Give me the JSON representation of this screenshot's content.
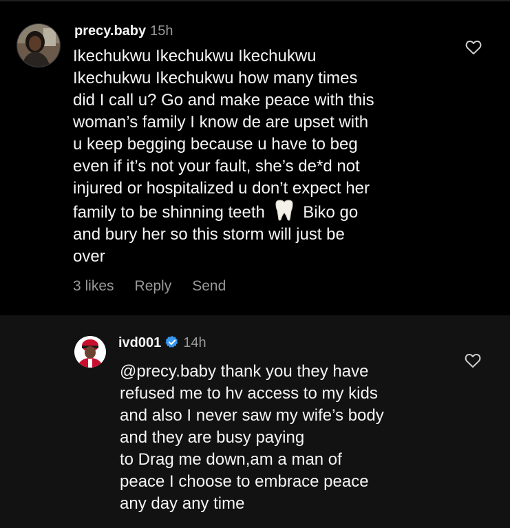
{
  "comments": [
    {
      "username": "precy.baby",
      "time": "15h",
      "lines": [
        "Ikechukwu Ikechukwu Ikechukwu",
        "Ikechukwu Ikechukwu how many times",
        "did I call u? Go and make peace with this",
        "woman’s family I know de are upset with",
        "u keep begging because u have to beg",
        "even if it’s not your fault, she’s de*d not",
        "injured or hospitalized u don’t expect her"
      ],
      "line8_before_emoji": "family to be shinning teeth",
      "line8_after_emoji": "Biko go",
      "lines_end": [
        "and bury her so this storm will just be",
        "over"
      ],
      "likes": "3 likes",
      "reply_label": "Reply",
      "send_label": "Send",
      "icons": {
        "avatar": "avatar-photo",
        "like": "heart-icon",
        "emoji": "tooth-emoji"
      }
    },
    {
      "username": "ivd001",
      "time": "14h",
      "lines": [
        "@precy.baby thank you they have",
        "refused me to hv access to my kids",
        "and also I never saw my wife’s body",
        "and they are busy paying",
        "to Drag me down,am a man of",
        "peace I choose to embrace peace",
        "any day any time"
      ],
      "icons": {
        "avatar": "avatar-photo",
        "verified": "verified-badge-icon",
        "like": "heart-icon"
      }
    }
  ],
  "colors": {
    "background": "#000000",
    "reply_background": "#121212",
    "text": "#f5f5f5",
    "secondary_text": "#9a9a9a",
    "verified_blue": "#3897f0"
  }
}
